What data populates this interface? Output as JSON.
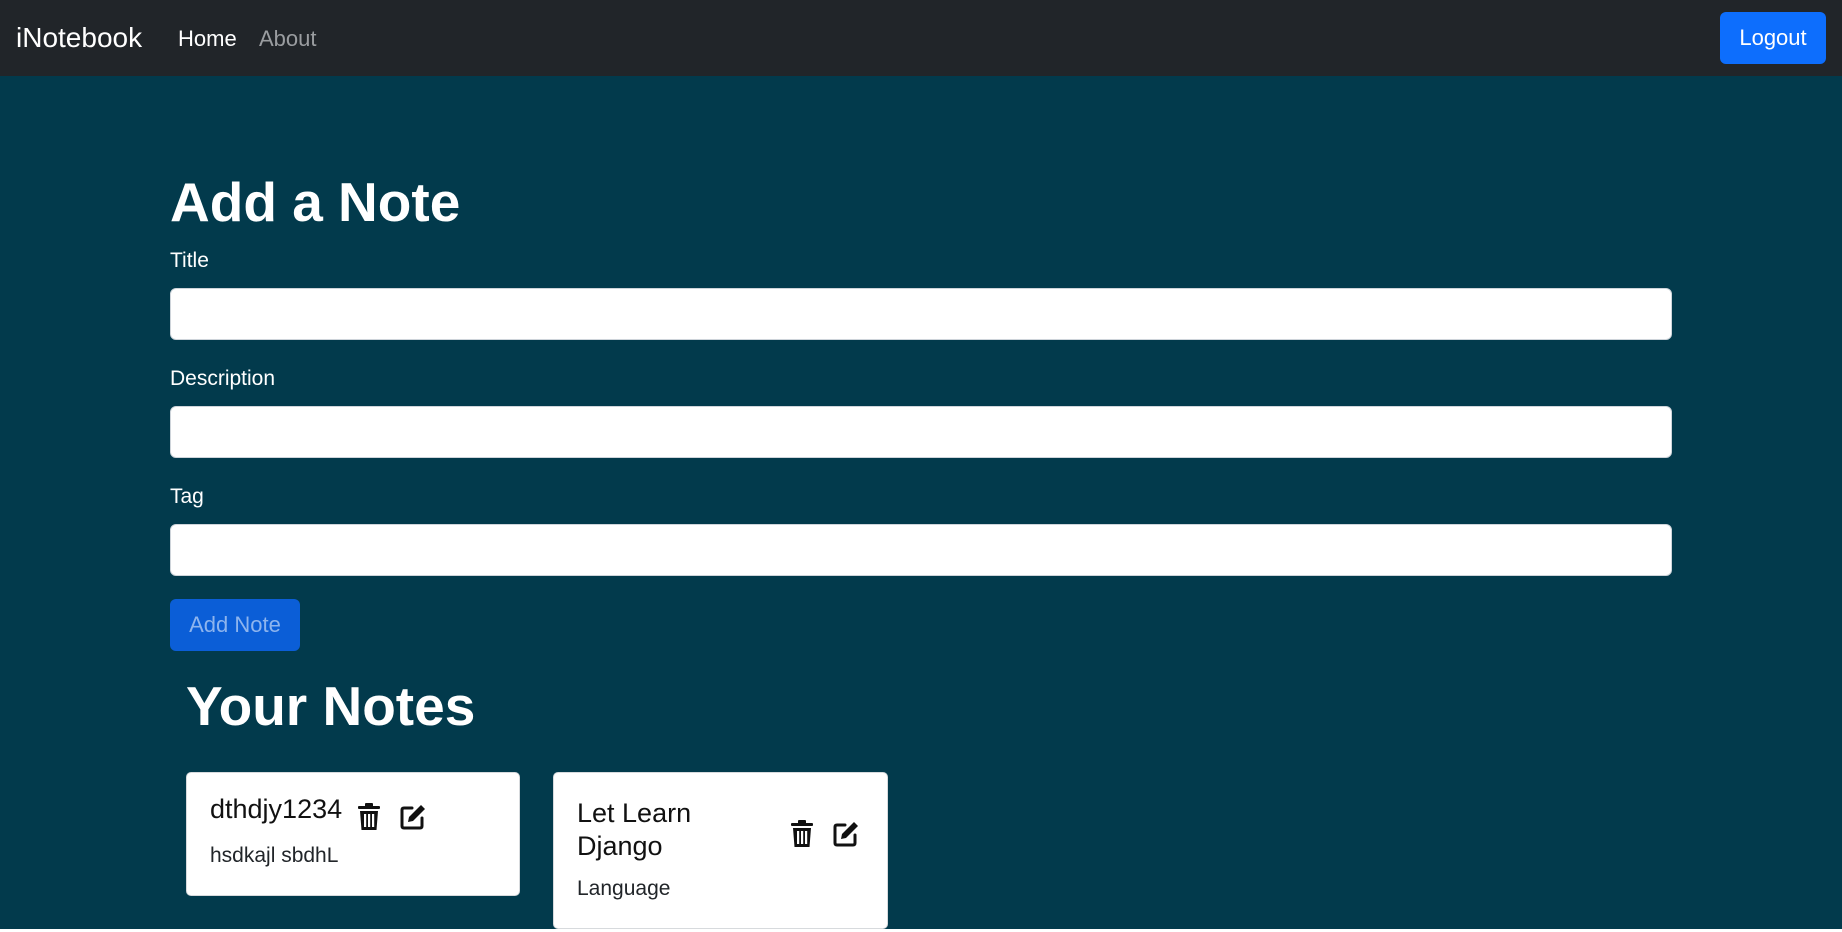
{
  "navbar": {
    "brand": "iNotebook",
    "links": [
      {
        "label": "Home"
      },
      {
        "label": "About"
      }
    ],
    "logout_label": "Logout"
  },
  "form": {
    "heading": "Add a Note",
    "title_label": "Title",
    "title_value": "",
    "description_label": "Description",
    "description_value": "",
    "tag_label": "Tag",
    "tag_value": "",
    "submit_label": "Add Note"
  },
  "notes": {
    "heading": "Your Notes",
    "items": [
      {
        "title": "dthdjy1234",
        "description": "hsdkajl sbdhL",
        "icons": [
          "trash-icon",
          "edit-icon"
        ]
      },
      {
        "title": "Let Learn Django",
        "description": "Language",
        "icons": [
          "trash-icon",
          "edit-icon"
        ]
      }
    ]
  },
  "colors": {
    "navbar_bg": "#212529",
    "page_bg": "#023a4c",
    "primary": "#0d6efd",
    "card_bg": "#ffffff"
  }
}
